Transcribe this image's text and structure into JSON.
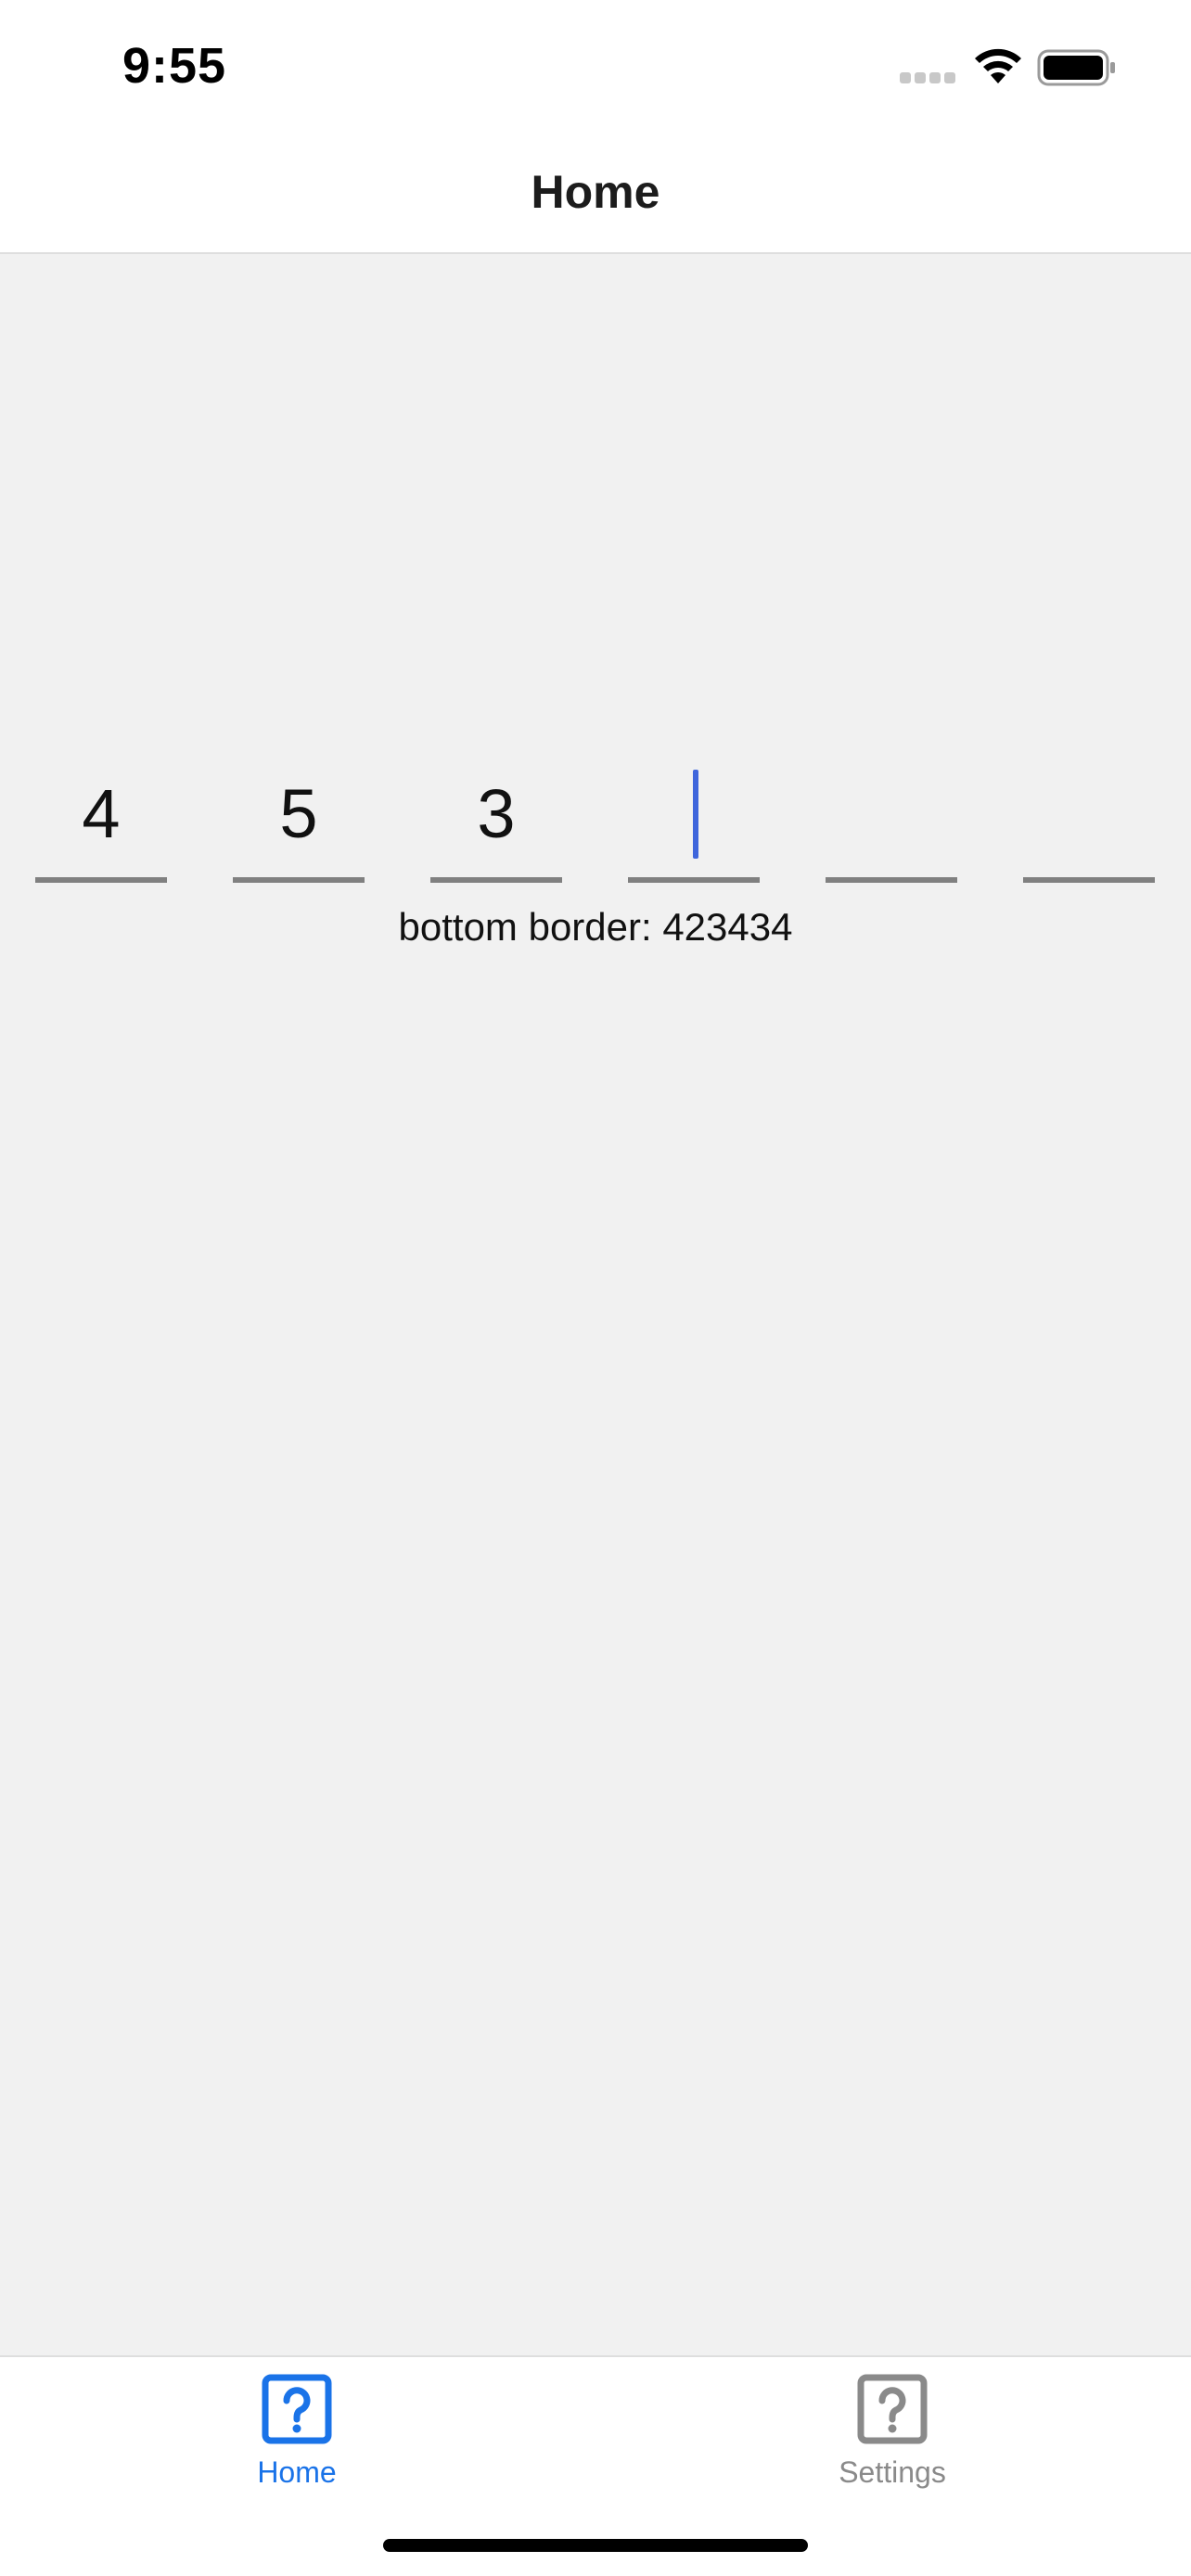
{
  "status_bar": {
    "time": "9:55"
  },
  "nav": {
    "title": "Home"
  },
  "otp": {
    "cells": [
      {
        "value": "4",
        "focused": false
      },
      {
        "value": "5",
        "focused": false
      },
      {
        "value": "3",
        "focused": false
      },
      {
        "value": "",
        "focused": true
      },
      {
        "value": "",
        "focused": false
      },
      {
        "value": "",
        "focused": false
      }
    ],
    "caption": "bottom border: 423434"
  },
  "tab_bar": {
    "items": [
      {
        "label": "Home",
        "icon": "question-square-icon",
        "active": true
      },
      {
        "label": "Settings",
        "icon": "question-square-icon",
        "active": false
      }
    ]
  },
  "colors": {
    "accent": "#1a73e8",
    "inactive": "#8a8a8a",
    "caret": "#3f66dc",
    "underline": "#808080",
    "background": "#f1f1f1"
  }
}
